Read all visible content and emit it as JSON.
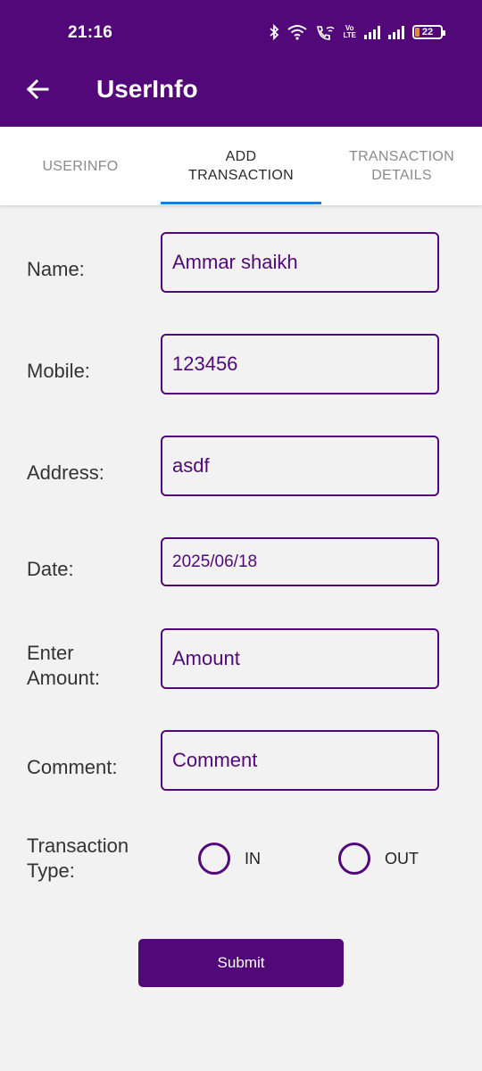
{
  "status_bar": {
    "time": "21:16",
    "battery": "22",
    "volte": "Vo\nLTE",
    "icons": [
      "bluetooth-icon",
      "wifi-icon",
      "wifi-call-icon",
      "volte-icon",
      "signal-icon",
      "signal-icon",
      "battery-icon"
    ]
  },
  "app_bar": {
    "title": "UserInfo",
    "back_icon": "arrow-left-icon"
  },
  "tabs": [
    {
      "label": "USERINFO"
    },
    {
      "label": "ADD TRANSACTION"
    },
    {
      "label": "TRANSACTION DETAILS"
    }
  ],
  "form": {
    "name_label": "Name:",
    "name_value": "Ammar shaikh",
    "mobile_label": "Mobile:",
    "mobile_value": "123456",
    "address_label": "Address:",
    "address_value": "asdf",
    "date_label": "Date:",
    "date_value": "2025/06/18",
    "amount_label": "Enter Amount:",
    "amount_placeholder": "Amount",
    "comment_label": "Comment:",
    "comment_placeholder": "Comment",
    "type_label": "Transaction Type:",
    "in_label": "IN",
    "out_label": "OUT",
    "submit_label": "Submit"
  },
  "colors": {
    "primary": "#520879",
    "tab_indicator": "#1f7bd8",
    "background": "#f2f2f2"
  }
}
